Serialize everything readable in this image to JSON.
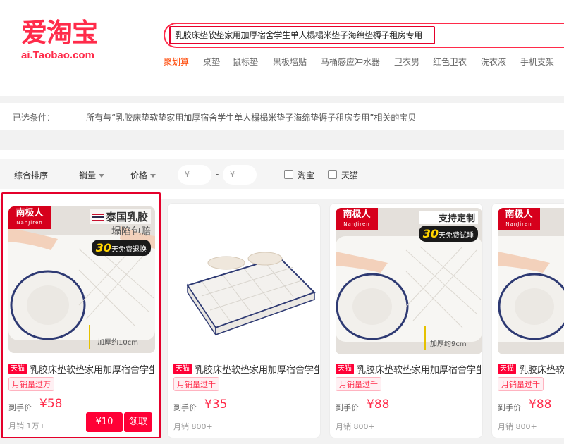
{
  "logo": {
    "cn": "爱淘宝",
    "en": "ai.Taobao.com"
  },
  "search": {
    "query": "乳胶床垫软垫家用加厚宿舍学生单人榻榻米垫子海绵垫褥子租房专用"
  },
  "hot_words": [
    "聚划算",
    "桌垫",
    "鼠标垫",
    "黑板墙贴",
    "马桶感应冲水器",
    "卫衣男",
    "红色卫衣",
    "洗衣液",
    "手机支架"
  ],
  "conditions": {
    "label": "已选条件：",
    "text": "所有与“乳胶床垫软垫家用加厚宿舍学生单人榻榻米垫子海绵垫褥子租房专用”相关的宝贝"
  },
  "sort": {
    "default": "综合排序",
    "sales": "销量",
    "price": "价格",
    "min_placeholder": "¥",
    "max_placeholder": "¥",
    "dash": "-",
    "taobao": "淘宝",
    "tmall": "天猫"
  },
  "colors": {
    "accent": "#ff2b4a",
    "tmall": "#ff0036",
    "highlight_border": "#e4002b"
  },
  "products": [
    {
      "badge": "天猫",
      "title": "乳胶床垫软垫家用加厚宿舍学生单人榻榻米垫子海绵垫褥子租房专用",
      "sales_tag": "月销量过万",
      "price_label": "到手价",
      "price": "¥58",
      "monthly": "月销 1万+",
      "coupon_value": "¥10",
      "coupon_action": "领取",
      "image": {
        "brand": "南极人",
        "brand_en": "NanJiren",
        "promo_title": "泰国乳胶",
        "promo_sub": "塌陷包赔",
        "pill_num": "30",
        "pill_text": "天免费退换",
        "thickness": "加厚约10cm"
      }
    },
    {
      "badge": "天猫",
      "title": "乳胶床垫软垫家用加厚宿舍学生单人榻榻米垫子海绵垫褥子租房专用",
      "sales_tag": "月销量过千",
      "price_label": "到手价",
      "price": "¥35",
      "monthly": "月销 800+"
    },
    {
      "badge": "天猫",
      "title": "乳胶床垫软垫家用加厚宿舍学生单人榻榻米垫子海绵垫褥子租房专用",
      "sales_tag": "月销量过千",
      "price_label": "到手价",
      "price": "¥88",
      "monthly": "月销 800+",
      "image": {
        "brand": "南极人",
        "brand_en": "NanJiren",
        "promo_title": "支持定制",
        "pill_num": "30",
        "pill_text": "天免费试睡",
        "thickness": "加厚约9cm"
      }
    },
    {
      "badge": "天猫",
      "title": "乳胶床垫软垫家用加厚宿舍学生单人榻榻米垫子海绵垫褥子租房专用",
      "sales_tag": "月销量过千",
      "price_label": "到手价",
      "price": "¥88",
      "monthly": "月销 800+",
      "image": {
        "brand": "南极人",
        "brand_en": "NanJiren"
      }
    }
  ]
}
